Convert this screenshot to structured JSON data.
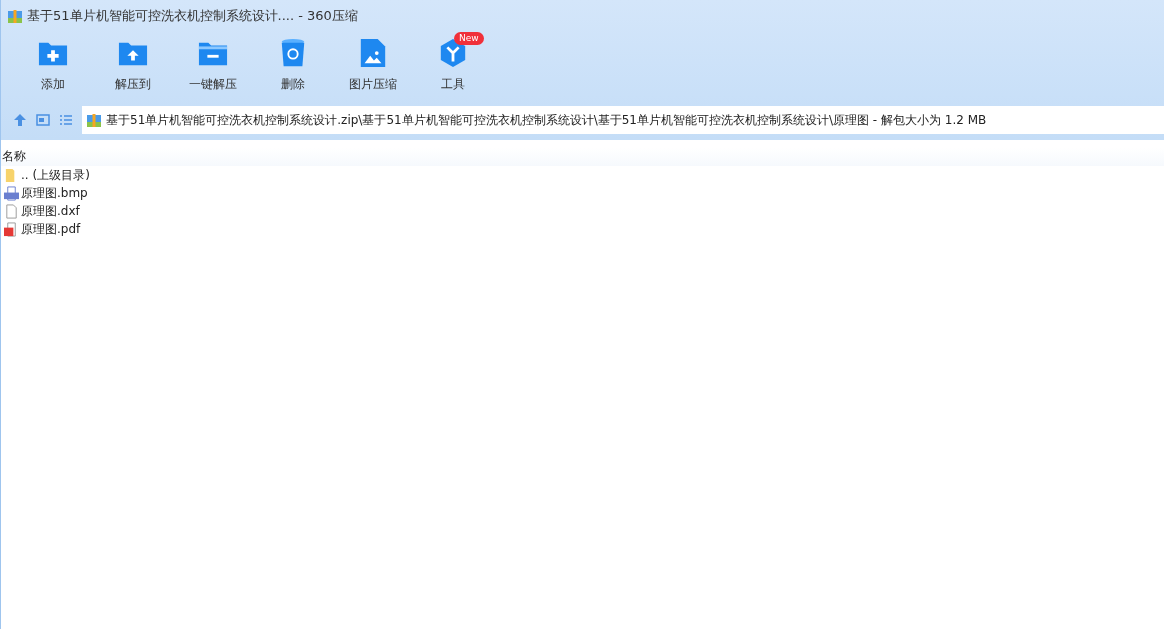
{
  "window": {
    "title": "基于51单片机智能可控洗衣机控制系统设计.... - 360压缩"
  },
  "toolbar": [
    {
      "label": "添加",
      "kind": "add"
    },
    {
      "label": "解压到",
      "kind": "extract"
    },
    {
      "label": "一键解压",
      "kind": "oneclick"
    },
    {
      "label": "删除",
      "kind": "delete"
    },
    {
      "label": "图片压缩",
      "kind": "image"
    },
    {
      "label": "工具",
      "kind": "tools",
      "badge": "New"
    }
  ],
  "address_bar": {
    "path": "基于51单片机智能可控洗衣机控制系统设计.zip\\基于51单片机智能可控洗衣机控制系统设计\\基于51单片机智能可控洗衣机控制系统设计\\原理图 - 解包大小为 1.2 MB"
  },
  "file_list": {
    "columns": [
      "名称"
    ],
    "rows": [
      {
        "name": ".. (上级目录)",
        "kind": "folder"
      },
      {
        "name": "原理图.bmp",
        "kind": "bmp"
      },
      {
        "name": "原理图.dxf",
        "kind": "file"
      },
      {
        "name": "原理图.pdf",
        "kind": "pdf"
      }
    ]
  }
}
